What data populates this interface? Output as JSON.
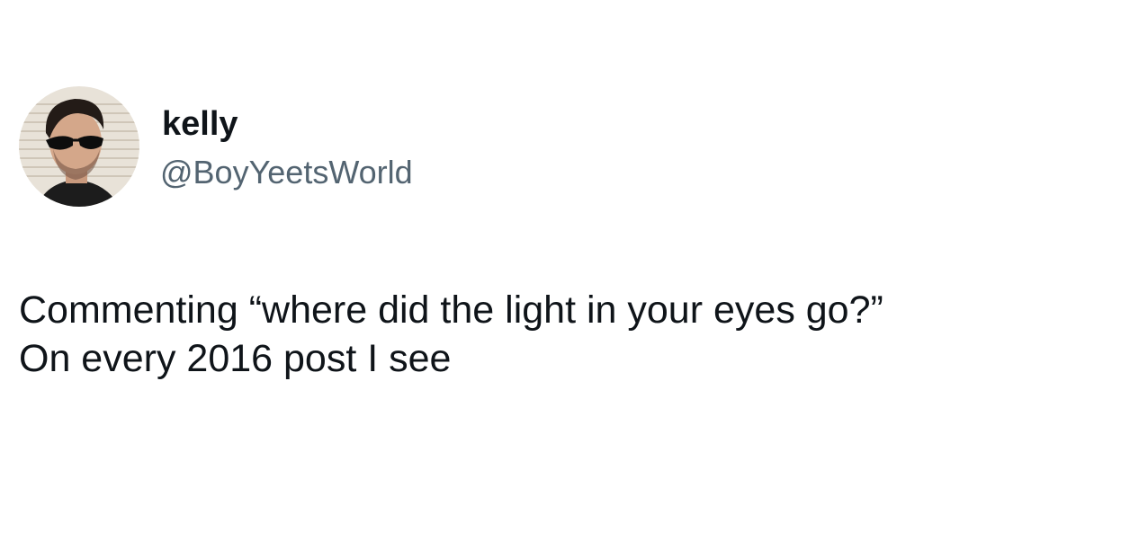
{
  "author": {
    "display_name": "kelly",
    "handle": "@BoyYeetsWorld",
    "avatar_icon": "profile-photo"
  },
  "tweet": {
    "lines": [
      "Commenting “where did the light in your eyes go?”",
      "On every 2016 post I see"
    ]
  },
  "colors": {
    "name": "#0f1419",
    "handle": "#536471",
    "background": "#ffffff"
  }
}
